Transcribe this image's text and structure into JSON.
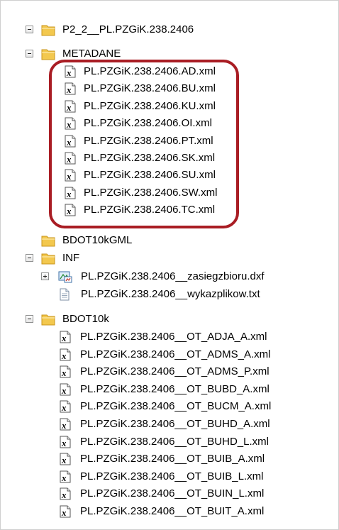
{
  "tree": {
    "root": {
      "label": "P2_2__PL.PZGiK.238.2406"
    },
    "metadane": {
      "label": "METADANE",
      "files": [
        "PL.PZGiK.238.2406.AD.xml",
        "PL.PZGiK.238.2406.BU.xml",
        "PL.PZGiK.238.2406.KU.xml",
        "PL.PZGiK.238.2406.OI.xml",
        "PL.PZGiK.238.2406.PT.xml",
        "PL.PZGiK.238.2406.SK.xml",
        "PL.PZGiK.238.2406.SU.xml",
        "PL.PZGiK.238.2406.SW.xml",
        "PL.PZGiK.238.2406.TC.xml"
      ]
    },
    "bdot10kgml": {
      "label": "BDOT10kGML"
    },
    "inf": {
      "label": "INF",
      "files": [
        {
          "label": "PL.PZGiK.238.2406__zasiegzbioru.dxf",
          "icon": "cad-dxf-icon"
        },
        {
          "label": "PL.PZGiK.238.2406__wykazplikow.txt",
          "icon": "text-file-icon"
        }
      ]
    },
    "bdot10k": {
      "label": "BDOT10k",
      "files": [
        "PL.PZGiK.238.2406__OT_ADJA_A.xml",
        "PL.PZGiK.238.2406__OT_ADMS_A.xml",
        "PL.PZGiK.238.2406__OT_ADMS_P.xml",
        "PL.PZGiK.238.2406__OT_BUBD_A.xml",
        "PL.PZGiK.238.2406__OT_BUCM_A.xml",
        "PL.PZGiK.238.2406__OT_BUHD_A.xml",
        "PL.PZGiK.238.2406__OT_BUHD_L.xml",
        "PL.PZGiK.238.2406__OT_BUIB_A.xml",
        "PL.PZGiK.238.2406__OT_BUIB_L.xml",
        "PL.PZGiK.238.2406__OT_BUIN_L.xml",
        "PL.PZGiK.238.2406__OT_BUIT_A.xml"
      ]
    }
  },
  "colors": {
    "highlight": "#a91d24",
    "folder": "#f3c84e",
    "folder_edge": "#c9961c"
  }
}
